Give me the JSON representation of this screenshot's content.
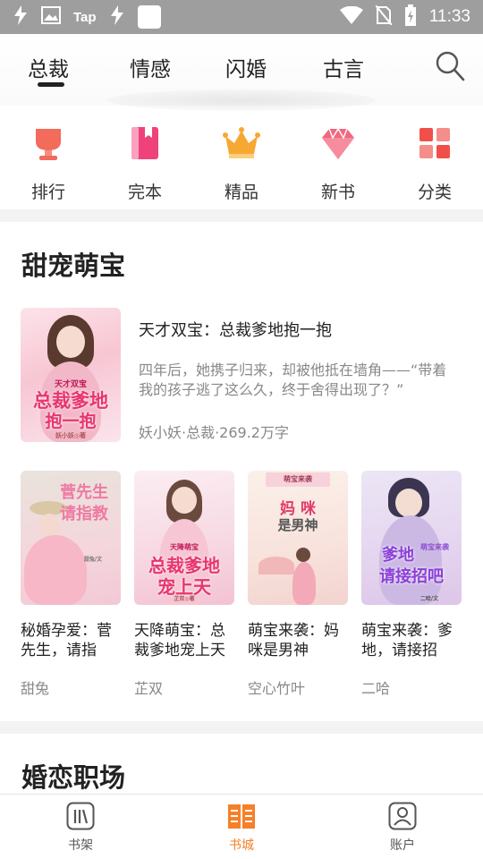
{
  "status_bar": {
    "left_icons": [
      "bolt-icon",
      "image-icon",
      "tap-icon",
      "bolt-icon",
      "square-icon"
    ],
    "tap_label": "Tap",
    "time": "11:33",
    "right_icons": [
      "wifi-icon",
      "no-sim-icon",
      "battery-charging-icon"
    ]
  },
  "top_tabs": {
    "items": [
      {
        "label": "总裁",
        "active": true
      },
      {
        "label": "情感",
        "active": false
      },
      {
        "label": "闪婚",
        "active": false
      },
      {
        "label": "古言",
        "active": false
      }
    ],
    "search_icon": "search-icon"
  },
  "categories": [
    {
      "label": "排行",
      "icon": "trophy-icon",
      "color": "#f26b5b"
    },
    {
      "label": "完本",
      "icon": "book-icon",
      "color": "#f0427a"
    },
    {
      "label": "精品",
      "icon": "crown-icon",
      "color": "#f7a833"
    },
    {
      "label": "新书",
      "icon": "diamond-icon",
      "color": "#f2687f"
    },
    {
      "label": "分类",
      "icon": "grid-icon",
      "color": "#f1504a"
    }
  ],
  "sections": [
    {
      "title": "甜宠萌宝",
      "featured": {
        "title": "天才双宝：总裁爹地抱一抱",
        "description": "四年后，她携子归来，却被他抵在墙角——“带着我的孩子逃了这么久，终于舍得出现了？”",
        "meta": "妖小妖·总裁·269.2万字",
        "cover_text_top": "天才双宝",
        "cover_text_main": "总裁爹地",
        "cover_text_sub": "抱一抱",
        "cover_author": "妖小妖◎著"
      },
      "books": [
        {
          "title": "秘婚孕爱：菅先生，请指",
          "author": "甜兔",
          "cover_line1": "菅先生",
          "cover_line2": "请指教",
          "cover_author": "甜兔/文"
        },
        {
          "title": "天降萌宝：总裁爹地宠上天",
          "author": "芷双",
          "cover_line1": "总裁爹地",
          "cover_line2": "宠上天",
          "cover_top": "天降萌宝",
          "cover_author": "芷双◎著"
        },
        {
          "title": "萌宝来袭：妈咪是男神",
          "author": "空心竹叶",
          "cover_line1": "妈 咪",
          "cover_line2": "是男神",
          "cover_top": "萌宝来袭"
        },
        {
          "title": "萌宝来袭：爹地，请接招",
          "author": "二哈",
          "cover_line1": "爹地",
          "cover_line2": "请接招吧",
          "cover_top": "萌宝来袭",
          "cover_author": "二哈/文"
        }
      ]
    },
    {
      "title": "婚恋职场"
    }
  ],
  "bottom_nav": [
    {
      "label": "书架",
      "icon": "bookshelf-icon",
      "active": false
    },
    {
      "label": "书城",
      "icon": "bookstore-icon",
      "active": true
    },
    {
      "label": "账户",
      "icon": "account-icon",
      "active": false
    }
  ],
  "colors": {
    "accent": "#f5802a",
    "title_pink": "#e8356f"
  }
}
